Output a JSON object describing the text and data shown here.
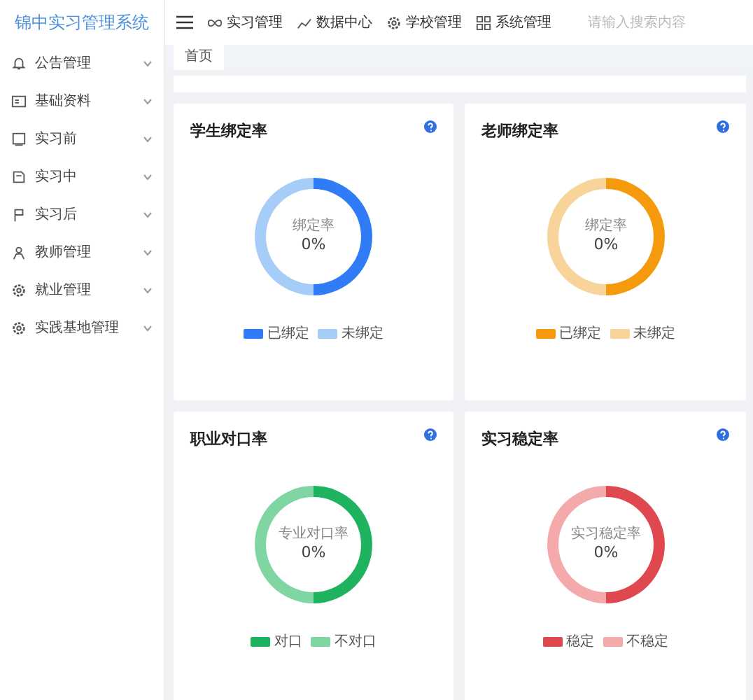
{
  "sidebar": {
    "logo": "锦中实习管理系统",
    "items": [
      {
        "label": "公告管理",
        "expanded": false
      },
      {
        "label": "基础资料",
        "expanded": false
      },
      {
        "label": "实习前",
        "expanded": false
      },
      {
        "label": "实习中",
        "expanded": false
      },
      {
        "label": "实习后",
        "expanded": false
      },
      {
        "label": "教师管理",
        "expanded": false
      },
      {
        "label": "就业管理",
        "expanded": false
      },
      {
        "label": "实践基地管理",
        "expanded": false
      }
    ]
  },
  "header": {
    "nav": [
      {
        "label": "实习管理"
      },
      {
        "label": "数据中心"
      },
      {
        "label": "学校管理"
      },
      {
        "label": "系统管理"
      }
    ],
    "search": {
      "placeholder": "请输入搜索内容"
    }
  },
  "tabs": [
    {
      "label": "首页",
      "selected": true
    }
  ],
  "cards": [
    {
      "title": "学生绑定率",
      "center_label": "绑定率",
      "center_value": "0%",
      "legend": [
        {
          "label": "已绑定",
          "color": "#2f7cf6"
        },
        {
          "label": "未绑定",
          "color": "#a6cdf8"
        }
      ]
    },
    {
      "title": "老师绑定率",
      "center_label": "绑定率",
      "center_value": "0%",
      "legend": [
        {
          "label": "已绑定",
          "color": "#f59a0c"
        },
        {
          "label": "未绑定",
          "color": "#f8d49a"
        }
      ]
    },
    {
      "title": "职业对口率",
      "center_label": "专业对口率",
      "center_value": "0%",
      "legend": [
        {
          "label": "对口",
          "color": "#1fb35f"
        },
        {
          "label": "不对口",
          "color": "#7fd6a2"
        }
      ]
    },
    {
      "title": "实习稳定率",
      "center_label": "实习稳定率",
      "center_value": "0%",
      "legend": [
        {
          "label": "稳定",
          "color": "#e0484f"
        },
        {
          "label": "不稳定",
          "color": "#f4a9ab"
        }
      ]
    }
  ]
}
